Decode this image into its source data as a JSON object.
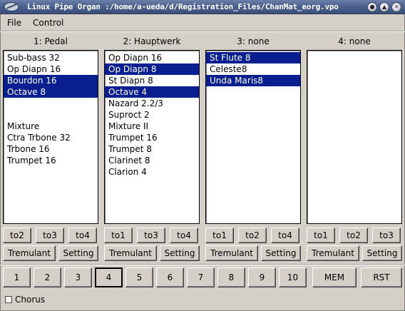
{
  "window": {
    "title": "Linux Pipe Organ :/home/a-ueda/d/Registration_Files/ChanMat_eorg.vpo",
    "minimize_icon": "minimize-icon",
    "maximize_icon": "maximize-icon",
    "close_icon": "close-icon"
  },
  "menu": {
    "file": "File",
    "control": "Control"
  },
  "columns": [
    {
      "header": "1: Pedal",
      "stops": [
        {
          "label": "Sub-bass 32",
          "selected": false
        },
        {
          "label": "Op Diapn 16",
          "selected": false
        },
        {
          "label": "Bourdon 16",
          "selected": true
        },
        {
          "label": "Octave 8",
          "selected": true
        },
        {
          "label": "",
          "selected": false
        },
        {
          "label": "",
          "selected": false
        },
        {
          "label": "Mixture",
          "selected": false
        },
        {
          "label": "Ctra Trbone 32",
          "selected": false
        },
        {
          "label": "Trbone 16",
          "selected": false
        },
        {
          "label": "Trumpet 16",
          "selected": false
        }
      ],
      "couplers": [
        "to2",
        "to3",
        "to4"
      ],
      "tremulant": "Tremulant",
      "setting": "Setting"
    },
    {
      "header": "2: Hauptwerk",
      "stops": [
        {
          "label": "Op Diapn 16",
          "selected": false
        },
        {
          "label": "Op Diapn 8",
          "selected": true
        },
        {
          "label": "St Diapn 8",
          "selected": false
        },
        {
          "label": "Octave 4",
          "selected": true
        },
        {
          "label": "Nazard 2.2/3",
          "selected": false
        },
        {
          "label": "Suproct 2",
          "selected": false
        },
        {
          "label": "Mixture II",
          "selected": false
        },
        {
          "label": "Trumpet 16",
          "selected": false
        },
        {
          "label": "Trumpet 8",
          "selected": false
        },
        {
          "label": "Clarinet 8",
          "selected": false
        },
        {
          "label": "Clarion 4",
          "selected": false
        }
      ],
      "couplers": [
        "to1",
        "to3",
        "to4"
      ],
      "tremulant": "Tremulant",
      "setting": "Setting"
    },
    {
      "header": "3: none",
      "stops": [
        {
          "label": "St Flute 8",
          "selected": true
        },
        {
          "label": "Celeste8",
          "selected": false
        },
        {
          "label": "Unda Maris8",
          "selected": true
        }
      ],
      "couplers": [
        "to1",
        "to2",
        "to4"
      ],
      "tremulant": "Tremulant",
      "setting": "Setting"
    },
    {
      "header": "4: none",
      "stops": [],
      "couplers": [
        "to1",
        "to2",
        "to3"
      ],
      "tremulant": "Tremulant",
      "setting": "Setting"
    }
  ],
  "presets": {
    "buttons": [
      "1",
      "2",
      "3",
      "4",
      "5",
      "6",
      "7",
      "8",
      "9",
      "10"
    ],
    "active": "4",
    "mem": "MEM",
    "rst": "RST"
  },
  "chorus": {
    "label": "Chorus",
    "checked": false
  }
}
